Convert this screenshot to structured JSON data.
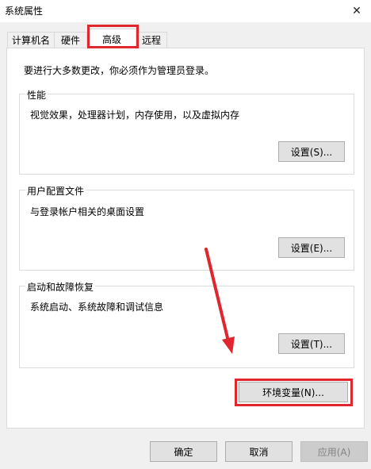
{
  "window": {
    "title": "系统属性",
    "close_glyph": "✕"
  },
  "tabs": [
    {
      "label": "计算机名",
      "active": false
    },
    {
      "label": "硬件",
      "active": false
    },
    {
      "label": "高级",
      "active": true
    },
    {
      "label": "远程",
      "active": false
    }
  ],
  "advanced": {
    "intro": "要进行大多数更改，你必须作为管理员登录。",
    "performance": {
      "label": "性能",
      "description": "视觉效果，处理器计划，内存使用，以及虚拟内存",
      "button": "设置(S)..."
    },
    "user_profiles": {
      "label": "用户配置文件",
      "description": "与登录帐户相关的桌面设置",
      "button": "设置(E)..."
    },
    "startup_recovery": {
      "label": "启动和故障恢复",
      "description": "系统启动、系统故障和调试信息",
      "button": "设置(T)..."
    },
    "env_button": "环境变量(N)..."
  },
  "footer": {
    "ok": "确定",
    "cancel": "取消",
    "apply": "应用(A)"
  },
  "annotation": {
    "color": "#e0262e"
  }
}
